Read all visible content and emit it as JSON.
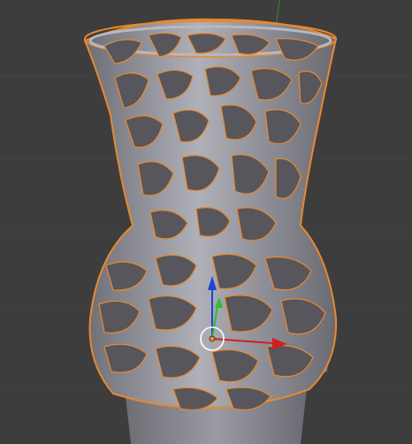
{
  "viewport": {
    "background": "#3d3d3d",
    "grid_line_color": "#474747",
    "object": {
      "name_hint": "voronoi-vase-mesh",
      "mesh_color": "#8a8a92",
      "mesh_light": "#b4b4bc",
      "mesh_shadow": "#55555c",
      "selection_outline": "#e8882e",
      "holes": "#555558"
    },
    "base_cylinder": {
      "color": "#8f8f97",
      "top_color": "#9fa0aa"
    },
    "gizmo": {
      "x_axis_color": "#d11f1f",
      "y_axis_color": "#2fbf2f",
      "z_axis_color": "#2042d6",
      "pivot_color": "#e8882e",
      "cursor_ring_color": "#ffffff"
    }
  }
}
